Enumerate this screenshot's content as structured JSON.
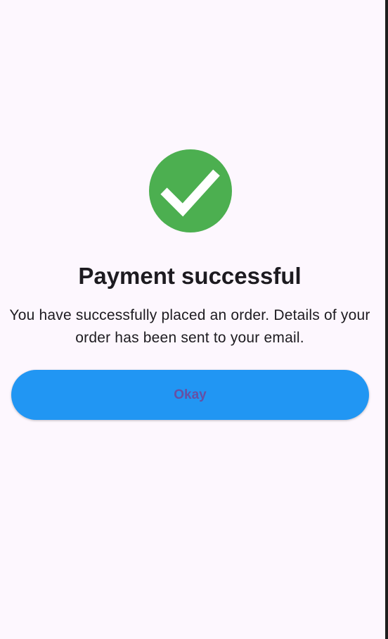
{
  "status": {
    "icon": "check-icon",
    "badge_color": "#4caf50",
    "title": "Payment successful",
    "message": "You have successfully placed an order. Details of your order has been sent to your email."
  },
  "actions": {
    "okay_label": "Okay",
    "button_color": "#2196f3",
    "label_color": "#6750a4"
  },
  "theme": {
    "background": "#fdf7fe",
    "text_color": "#1d1b20"
  }
}
